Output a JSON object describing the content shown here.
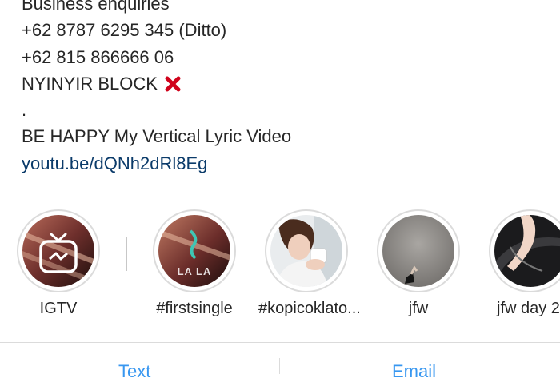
{
  "bio": {
    "lines": [
      "Business enquiries",
      "+62 8787 6295 345 (Ditto)",
      "+62 815 866666 06",
      "NYINYIR BLOCK",
      ".",
      "BE HAPPY My Vertical Lyric Video"
    ],
    "link": "youtu.be/dQNh2dRl8Eg",
    "block_icon": "red-cross-mark-icon"
  },
  "highlights": [
    {
      "label": "IGTV",
      "icon": "igtv-icon"
    },
    {
      "label": "#firstsingle",
      "overlay_text": "LA LA"
    },
    {
      "label": "#kopicoklato..."
    },
    {
      "label": "jfw"
    },
    {
      "label": "jfw day 2"
    }
  ],
  "bottom_actions": {
    "left": "Text",
    "right": "Email"
  },
  "colors": {
    "text": "#262626",
    "link": "#0b3b6a",
    "accent": "#3897f0",
    "ring": "#dbdbdb",
    "cross": "#d0021b"
  }
}
